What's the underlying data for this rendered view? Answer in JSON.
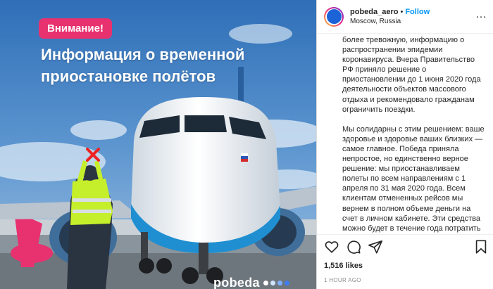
{
  "media": {
    "badge": "Внимание!",
    "headline": "Информация о временной приостановке полётов",
    "brand": "pobeda"
  },
  "post": {
    "username": "pobeda_aero",
    "separator": "•",
    "follow_label": "Follow",
    "location": "Moscow, Russia",
    "more": "…"
  },
  "caption": {
    "paragraphs": [
      "более тревожную, информацию о распространении эпидемии коронавируса. Вчера Правительство РФ приняло решение о приостановлении до 1 июня 2020 года деятельности объектов массового отдыха и рекомендовало гражданам ограничить поездки.",
      "Мы солидарны с этим решением: ваше здоровье и здоровье ваших близких — самое главное. Победа приняла непростое, но единственно верное решение: мы приостанавливаем полеты по всем направлениям с 1 апреля по 31 мая 2020 года. Всем клиентам отмененных рейсов мы вернем в полном объеме деньги на счет в личном кабинете. Эти средства можно будет в течение года потратить на оформление билетов на любые"
    ]
  },
  "actions": {
    "icons": [
      "heart-icon",
      "comment-icon",
      "share-icon",
      "bookmark-icon"
    ]
  },
  "likes": "1,516 likes",
  "timestamp": "1 HOUR AGO",
  "colors": {
    "badge": "#e8316f",
    "follow": "#0095f6",
    "sky": "#4f8ac4",
    "brand_blue": "#1c63d8"
  }
}
